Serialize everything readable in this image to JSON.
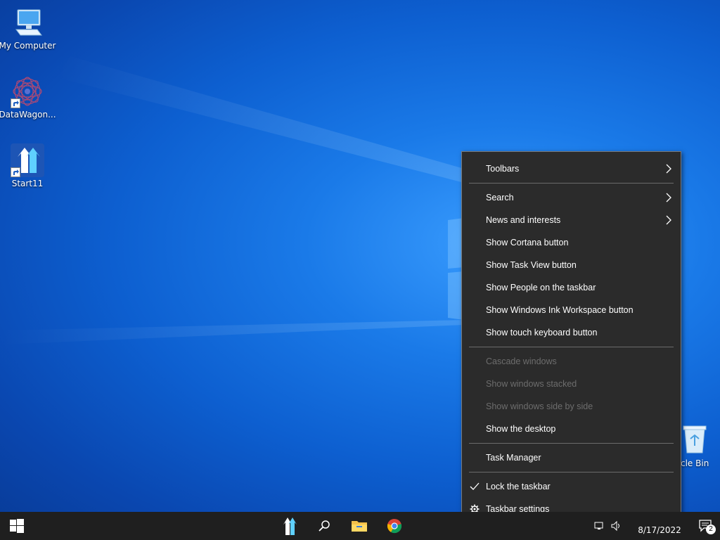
{
  "desktop": {
    "icons": [
      {
        "label": "My Computer",
        "icon": "computer-icon"
      },
      {
        "label": "DataWagon...",
        "icon": "datawagon-icon"
      },
      {
        "label": "Start11",
        "icon": "start11-icon"
      }
    ],
    "recycle_bin_label": "cle Bin"
  },
  "context_menu": {
    "toolbars": "Toolbars",
    "search": "Search",
    "news": "News and interests",
    "cortana": "Show Cortana button",
    "task_view": "Show Task View button",
    "people": "Show People on the taskbar",
    "ink": "Show Windows Ink Workspace button",
    "touch_keyboard": "Show touch keyboard button",
    "cascade": "Cascade windows",
    "stacked": "Show windows stacked",
    "side_by_side": "Show windows side by side",
    "show_desktop": "Show the desktop",
    "task_manager": "Task Manager",
    "lock": "Lock the taskbar",
    "settings": "Taskbar settings"
  },
  "taskbar": {
    "date": "8/17/2022",
    "notification_count": "2",
    "apps": [
      "start-button",
      "start11-icon",
      "search-icon",
      "file-explorer-icon",
      "chrome-icon"
    ]
  },
  "colors": {
    "menu_bg": "#2b2b2b",
    "taskbar_bg": "#1f1f1f",
    "disabled_text": "#6d6d6d"
  }
}
